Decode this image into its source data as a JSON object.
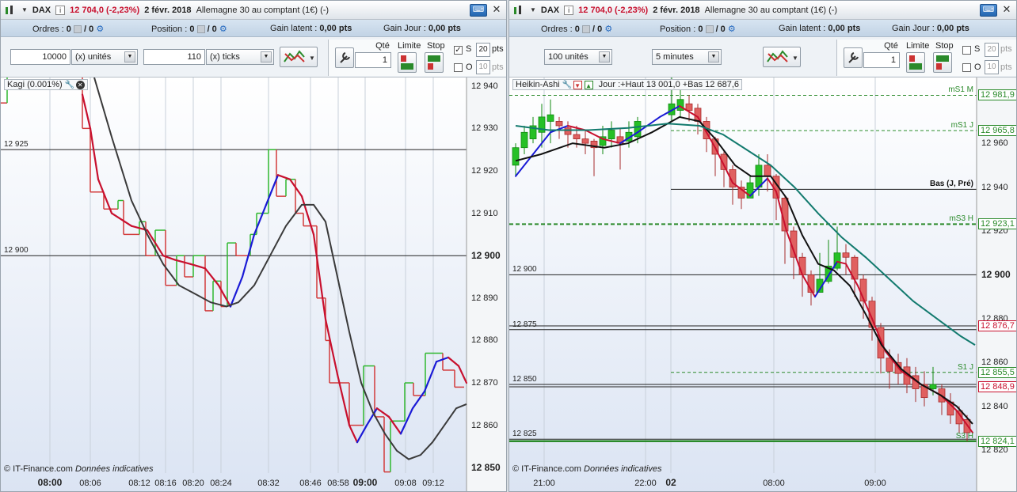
{
  "left": {
    "title": {
      "symbol": "DAX",
      "info": "i",
      "price": "12 704,0 (-2,23%)",
      "date": "2 févr. 2018",
      "description": "Allemagne 30 au comptant (1€) (-)"
    },
    "status": {
      "orders_label": "Ordres :",
      "orders_val": "0",
      "orders_val2": "/ 0",
      "position_label": "Position :",
      "position_val": "0",
      "position_val2": "/ 0",
      "latent_label": "Gain latent :",
      "latent_val": "0,00 pts",
      "day_label": "Gain Jour :",
      "day_val": "0,00 pts"
    },
    "toolbar": {
      "qty": "10000",
      "qty_unit": "(x) unités",
      "tick_val": "110",
      "tick_unit": "(x) ticks",
      "qte_label": "Qté",
      "qte_val": "1",
      "limite_label": "Limite",
      "stop_label": "Stop",
      "s_label": "S",
      "s_val": "20",
      "o_label": "O",
      "o_val": "10",
      "pts": "pts"
    },
    "chart": {
      "indicator": "Kagi (0.001%)",
      "copyright": "© IT-Finance.com",
      "copyright_note": "Données indicatives"
    },
    "y_ticks": [
      {
        "label": "12 940",
        "v": 12940
      },
      {
        "label": "12 930",
        "v": 12930
      },
      {
        "label": "12 920",
        "v": 12920
      },
      {
        "label": "12 910",
        "v": 12910
      },
      {
        "label": "12 900",
        "v": 12900,
        "bold": true
      },
      {
        "label": "12 890",
        "v": 12890
      },
      {
        "label": "12 880",
        "v": 12880
      },
      {
        "label": "12 870",
        "v": 12870
      },
      {
        "label": "12 860",
        "v": 12860
      },
      {
        "label": "12 850",
        "v": 12850,
        "bold": true
      }
    ],
    "h_lines": [
      {
        "label": "12 925",
        "v": 12925
      },
      {
        "label": "12 900",
        "v": 12900
      }
    ],
    "x_ticks": [
      {
        "label": "08:00",
        "bold": true
      },
      {
        "label": "08:06"
      },
      {
        "label": "08:12"
      },
      {
        "label": "08:16"
      },
      {
        "label": "08:20"
      },
      {
        "label": "08:24"
      },
      {
        "label": "08:32"
      },
      {
        "label": "08:46"
      },
      {
        "label": "08:58"
      },
      {
        "label": "09:00",
        "bold": true
      },
      {
        "label": "09:08"
      },
      {
        "label": "09:12"
      }
    ]
  },
  "right": {
    "title": {
      "symbol": "DAX",
      "info": "i",
      "price": "12 704,0 (-2,23%)",
      "date": "2 févr. 2018",
      "description": "Allemagne 30 au comptant (1€) (-)"
    },
    "status": {
      "orders_label": "Ordres :",
      "orders_val": "0",
      "orders_val2": "/ 0",
      "position_label": "Position :",
      "position_val": "0",
      "position_val2": "/ 0",
      "latent_label": "Gain latent :",
      "latent_val": "0,00 pts",
      "day_label": "Gain Jour :",
      "day_val": "0,00 pts"
    },
    "toolbar": {
      "units": "100 unités",
      "interval": "5 minutes",
      "qte_label": "Qté",
      "qte_val": "1",
      "limite_label": "Limite",
      "stop_label": "Stop",
      "s_label": "S",
      "s_val": "20",
      "o_label": "O",
      "o_val": "10",
      "pts": "pts"
    },
    "chart": {
      "indicator": "Heikin-Ashi",
      "day_info": "Jour :+Haut 13 001,0 +Bas 12 687,6",
      "copyright": "© IT-Finance.com",
      "copyright_note": "Données indicatives"
    },
    "y_ticks": [
      {
        "label": "12 960",
        "v": 12960
      },
      {
        "label": "12 940",
        "v": 12940
      },
      {
        "label": "12 920",
        "v": 12920
      },
      {
        "label": "12 900",
        "v": 12900,
        "bold": true
      },
      {
        "label": "12 880",
        "v": 12880
      },
      {
        "label": "12 860",
        "v": 12860
      },
      {
        "label": "12 840",
        "v": 12840
      },
      {
        "label": "12 820",
        "v": 12820
      }
    ],
    "h_lines": [
      {
        "label": "12 900",
        "v": 12900
      },
      {
        "label": "12 875",
        "v": 12875
      },
      {
        "label": "12 850",
        "v": 12850
      },
      {
        "label": "12 825",
        "v": 12825
      }
    ],
    "levels": [
      {
        "name": "mS1 M",
        "value": "12 981,9",
        "v": 12981.9
      },
      {
        "name": "mS1 J",
        "value": "12 965,8",
        "v": 12965.8
      },
      {
        "name": "Bas (J, Pré)",
        "value": "",
        "v": 12939
      },
      {
        "name": "mS3 H",
        "value": "12 923,1",
        "v": 12923.1
      },
      {
        "name": "",
        "value": "12 876,7",
        "v": 12876.7
      },
      {
        "name": "S1 J",
        "value": "12 855,5",
        "v": 12855.5
      },
      {
        "name": "",
        "value": "12 848,9",
        "v": 12848.9
      },
      {
        "name": "S3 H",
        "value": "12 824,1",
        "v": 12824.1
      }
    ],
    "x_ticks": [
      {
        "label": "21:00"
      },
      {
        "label": "22:00"
      },
      {
        "label": "02",
        "bold": true
      },
      {
        "label": "08:00"
      },
      {
        "label": "09:00"
      }
    ]
  },
  "colors": {
    "up": "#2fb82f",
    "down": "#d23a3a",
    "avg_red": "#c8102e",
    "avg_blue": "#1a1ad6",
    "avg_black": "#222222",
    "avg_teal": "#127a6e",
    "level": "#2a8a2a"
  },
  "chart_data": [
    {
      "type": "line",
      "title": "Kagi (0.001%)",
      "x": [
        "08:00",
        "08:06",
        "08:12",
        "08:16",
        "08:20",
        "08:24",
        "08:32",
        "08:46",
        "08:58",
        "09:00",
        "09:08",
        "09:12"
      ],
      "series": [
        {
          "values": [
            12945,
            12915,
            12907,
            12899,
            12897,
            12886,
            12919,
            12900,
            12872,
            12858,
            12866,
            12872
          ]
        }
      ],
      "ylim": [
        12848,
        12942
      ]
    },
    {
      "type": "line",
      "title": "Heikin-Ashi",
      "x": [
        "21:00",
        "22:00",
        "02",
        "08:00",
        "09:00"
      ],
      "series": [
        {
          "values": [
            12955,
            12960,
            12975,
            12950,
            12880
          ]
        }
      ],
      "ylim": [
        12815,
        12990
      ]
    }
  ]
}
